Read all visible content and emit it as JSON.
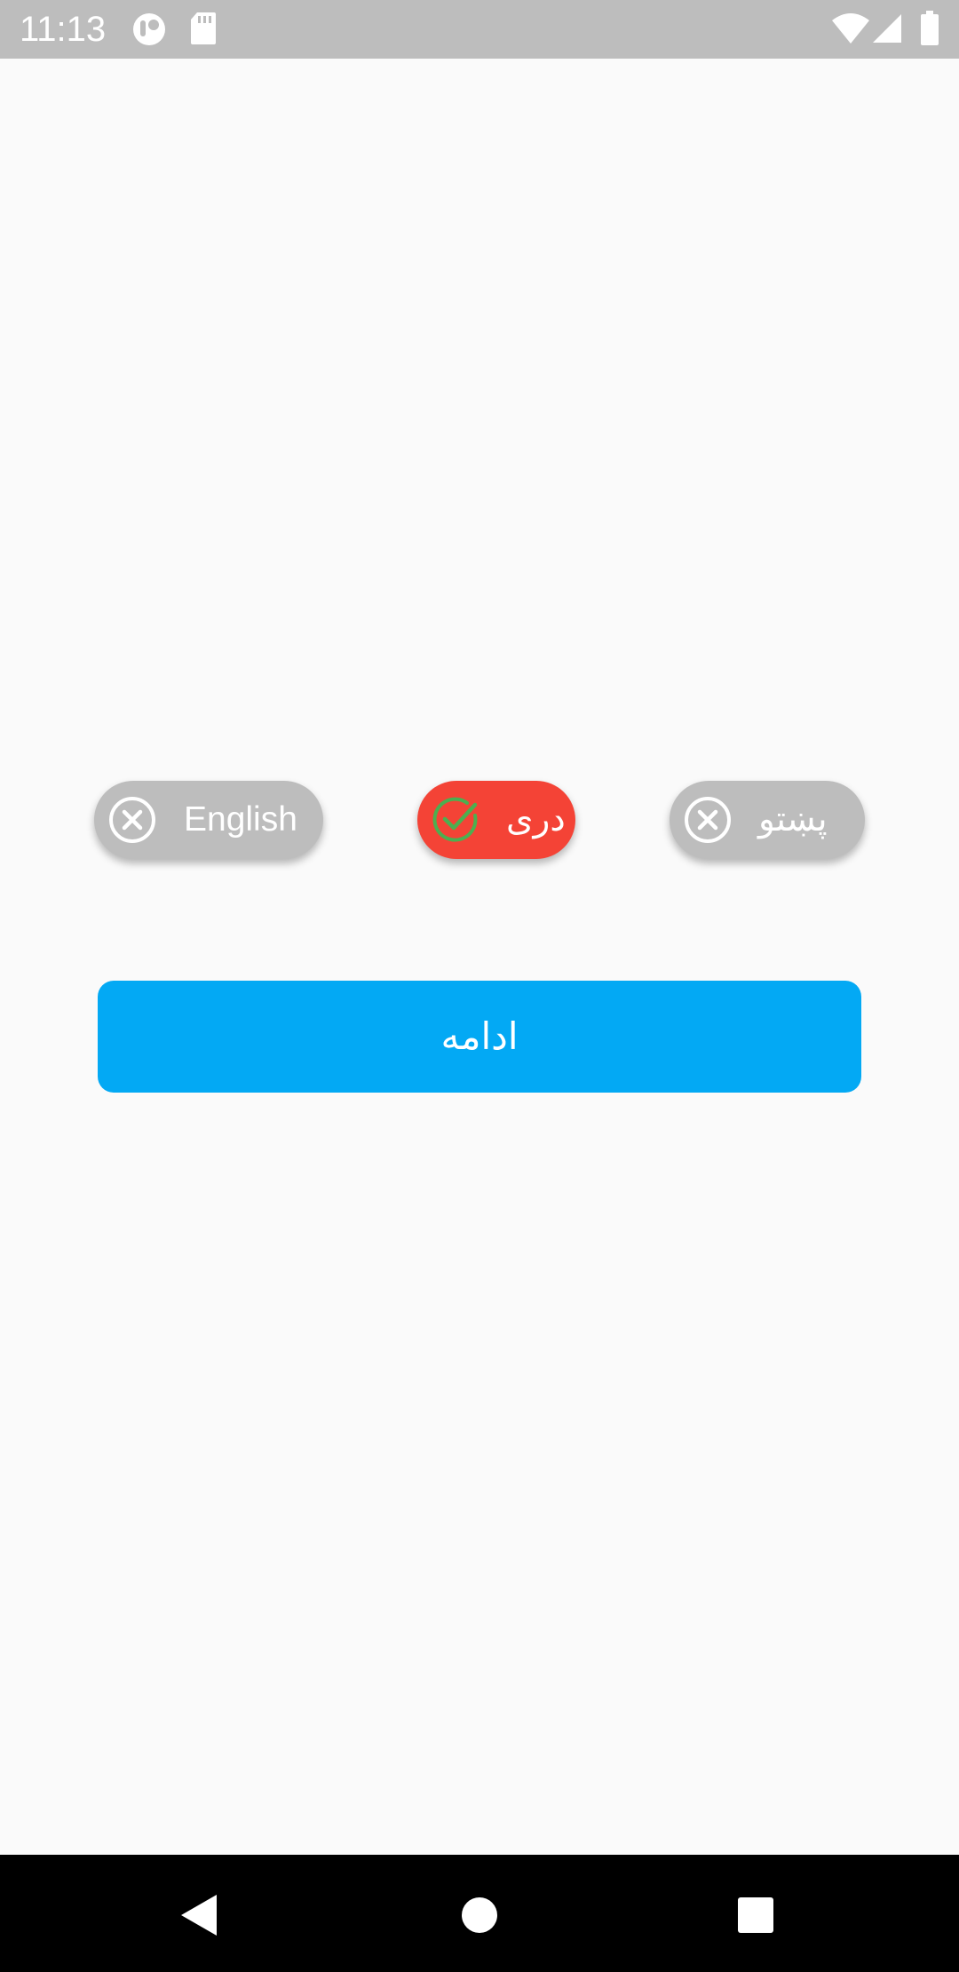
{
  "status_bar": {
    "time": "11:13",
    "icons": [
      "notification-app-icon",
      "sd-card-icon",
      "wifi-icon",
      "signal-icon",
      "battery-icon"
    ]
  },
  "language_options": [
    {
      "label": "English",
      "selected": false,
      "icon": "x-circle-icon"
    },
    {
      "label": "دری",
      "selected": true,
      "icon": "check-circle-icon"
    },
    {
      "label": "پښتو",
      "selected": false,
      "icon": "x-circle-icon"
    }
  ],
  "continue_button": {
    "label": "ادامه"
  },
  "nav_bar": {
    "buttons": [
      "back-icon",
      "home-icon",
      "recents-icon"
    ]
  },
  "colors": {
    "status_bar": "#bdbdbd",
    "chip_unselected": "#bdbdbd",
    "chip_selected": "#f44336",
    "check_icon": "#4caf50",
    "continue_button": "#03a9f4",
    "background": "#fafafa",
    "nav_bar": "#000000"
  }
}
